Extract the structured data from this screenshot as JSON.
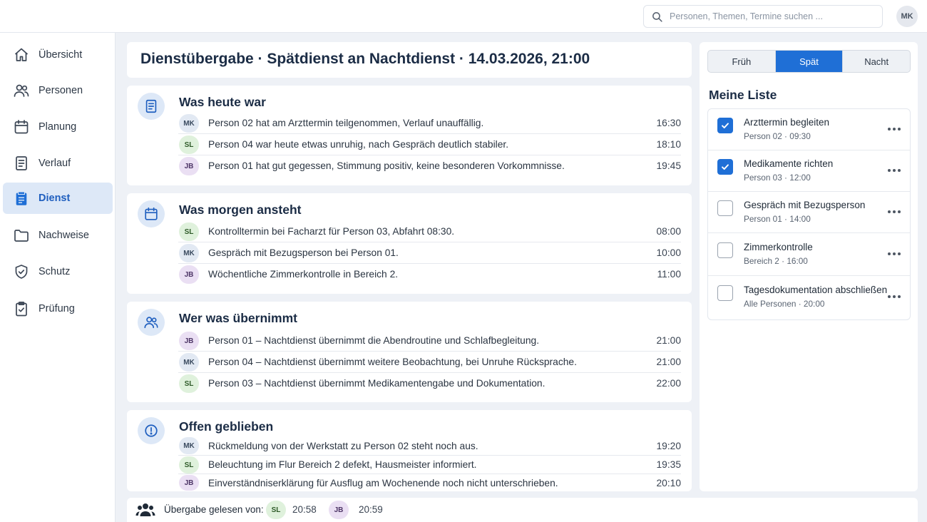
{
  "search": {
    "placeholder": "Personen, Themen, Termine suchen ..."
  },
  "user": {
    "initials": "MK"
  },
  "sidebar": {
    "items": [
      {
        "label": "Übersicht",
        "icon": "home-icon"
      },
      {
        "label": "Personen",
        "icon": "people-icon"
      },
      {
        "label": "Planung",
        "icon": "calendar-icon"
      },
      {
        "label": "Verlauf",
        "icon": "document-icon"
      },
      {
        "label": "Dienst",
        "icon": "clipboard-icon",
        "active": true
      },
      {
        "label": "Nachweise",
        "icon": "folder-icon"
      },
      {
        "label": "Schutz",
        "icon": "shield-icon"
      },
      {
        "label": "Prüfung",
        "icon": "clipboard-check-icon"
      }
    ]
  },
  "header": {
    "title": "Dienstübergabe · Spätdienst an Nachtdienst · 14.03.2026, 21:00"
  },
  "sections": [
    {
      "title": "Was heute war",
      "icon": "document-icon",
      "rows": [
        {
          "badge": "MK",
          "text": "Person 02 hat am Arzttermin teilgenommen, Verlauf unauffällig.",
          "time": "16:30"
        },
        {
          "badge": "SL",
          "text": "Person 04 war heute etwas unruhig, nach Gespräch deutlich stabiler.",
          "time": "18:10"
        },
        {
          "badge": "JB",
          "text": "Person 01 hat gut gegessen, Stimmung positiv, keine besonderen Vorkommnisse.",
          "time": "19:45"
        }
      ]
    },
    {
      "title": "Was morgen ansteht",
      "icon": "calendar-icon",
      "rows": [
        {
          "badge": "SL",
          "text": "Kontrolltermin bei Facharzt für Person 03, Abfahrt 08:30.",
          "time": "08:00"
        },
        {
          "badge": "MK",
          "text": "Gespräch mit Bezugsperson bei Person 01.",
          "time": "10:00"
        },
        {
          "badge": "JB",
          "text": "Wöchentliche Zimmerkontrolle in Bereich 2.",
          "time": "11:00"
        }
      ]
    },
    {
      "title": "Wer was übernimmt",
      "icon": "people-icon",
      "rows": [
        {
          "badge": "JB",
          "text": "Person 01 – Nachtdienst übernimmt die Abendroutine und Schlafbegleitung.",
          "time": "21:00"
        },
        {
          "badge": "MK",
          "text": "Person 04 – Nachtdienst übernimmt weitere Beobachtung, bei Unruhe Rücksprache.",
          "time": "21:00"
        },
        {
          "badge": "SL",
          "text": "Person 03 – Nachtdienst übernimmt Medikamentengabe und Dokumentation.",
          "time": "22:00"
        }
      ]
    },
    {
      "title": "Offen geblieben",
      "icon": "alert-icon",
      "rows": [
        {
          "badge": "MK",
          "text": "Rückmeldung von der Werkstatt zu Person 02 steht noch aus.",
          "time": "19:20"
        },
        {
          "badge": "SL",
          "text": "Beleuchtung im Flur Bereich 2 defekt, Hausmeister informiert.",
          "time": "19:35"
        },
        {
          "badge": "JB",
          "text": "Einverständniserklärung für Ausflug am Wochenende noch nicht unterschrieben.",
          "time": "20:10"
        }
      ]
    }
  ],
  "footer": {
    "label": "Übergabe gelesen von:",
    "readers": [
      {
        "badge": "SL",
        "time": "20:58"
      },
      {
        "badge": "JB",
        "time": "20:59"
      }
    ]
  },
  "shifts": {
    "options": [
      "Früh",
      "Spät",
      "Nacht"
    ],
    "selected": "Spät"
  },
  "my_list": {
    "title": "Meine Liste",
    "tasks": [
      {
        "title": "Arzttermin begleiten",
        "sub": "Person 02 · 09:30",
        "checked": true
      },
      {
        "title": "Medikamente richten",
        "sub": "Person 03 · 12:00",
        "checked": true
      },
      {
        "title": "Gespräch mit Bezugsperson",
        "sub": "Person 01 · 14:00",
        "checked": false
      },
      {
        "title": "Zimmerkontrolle",
        "sub": "Bereich 2 · 16:00",
        "checked": false
      },
      {
        "title": "Tagesdokumentation abschließen",
        "sub": "Alle Personen · 20:00",
        "checked": false
      }
    ]
  },
  "colors": {
    "accent": "#1f6fd6",
    "active_nav_bg": "#dde8f7",
    "badge_mk": "#e2e9f3",
    "badge_sl": "#dff1dc",
    "badge_jb": "#eadff3"
  }
}
